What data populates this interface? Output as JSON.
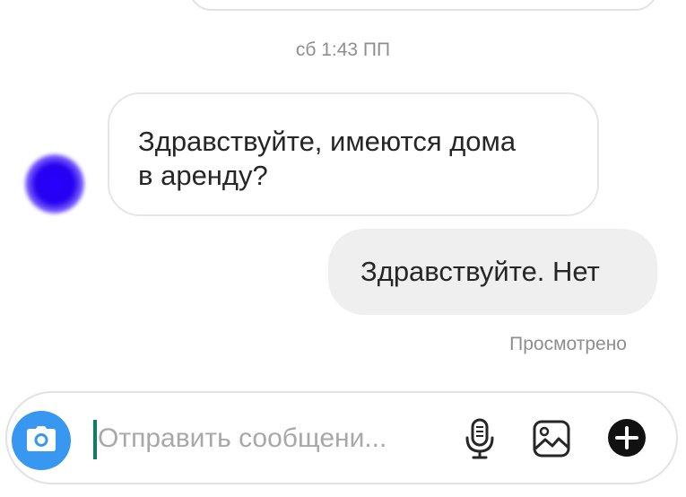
{
  "thread": {
    "timestamp": "сб 1:43 ПП",
    "messages": [
      {
        "direction": "incoming",
        "text_line1": "Здравствуйте, имеются дома",
        "text_line2": "в аренду?"
      },
      {
        "direction": "outgoing",
        "text": "Здравствуйте. Нет"
      }
    ],
    "seen_label": "Просмотрено"
  },
  "composer": {
    "placeholder": "Отправить сообщени...",
    "value": "",
    "icons": {
      "camera": "camera-icon",
      "mic": "microphone-icon",
      "gallery": "gallery-icon",
      "plus": "plus-circle-icon"
    }
  },
  "colors": {
    "camera_blue": "#3897f0",
    "bubble_outgoing": "#efefef",
    "caret_green": "#0f7d63",
    "avatar_blue": "#2400f0"
  }
}
